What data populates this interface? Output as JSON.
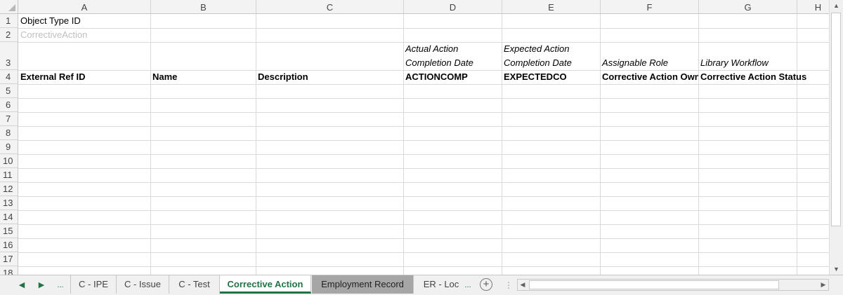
{
  "columns": [
    "A",
    "B",
    "C",
    "D",
    "E",
    "F",
    "G",
    "H"
  ],
  "rows": [
    "1",
    "2",
    "3",
    "4",
    "5",
    "6",
    "7",
    "8",
    "9",
    "10",
    "11",
    "12",
    "13",
    "14",
    "15",
    "16",
    "17",
    "18"
  ],
  "cells": {
    "a1": "Object Type ID",
    "a2": "CorrectiveAction",
    "d3_line1": "Actual Action",
    "d3_line2": "Completion Date",
    "e3_line1": "Expected Action",
    "e3_line2": "Completion Date",
    "f3": "Assignable Role",
    "g3": "Library Workflow",
    "a4": "External Ref ID",
    "b4": "Name",
    "c4": "Description",
    "d4": "ACTIONCOMP",
    "e4": "EXPECTEDCO",
    "f4": "Corrective Action Own",
    "g4": "Corrective Action Status"
  },
  "tabs": {
    "nav_prev": "◀",
    "nav_next": "▶",
    "ellipsis": "...",
    "items": [
      "C - IPE",
      "C - Issue",
      "C - Test",
      "Corrective Action",
      "Employment Record",
      "ER - Loc"
    ],
    "active": "Corrective Action",
    "more": "..."
  },
  "icons": {
    "add_sheet": "plus-circle-icon",
    "scroll_up": "triangle-up-icon",
    "scroll_down": "triangle-down-icon",
    "scroll_left": "triangle-left-icon",
    "scroll_right": "triangle-right-icon"
  },
  "colors": {
    "accent": "#217346",
    "colored_tab": "#a6a6a6",
    "header_bg": "#f3f3f3",
    "ghost_text": "#c0c0c0"
  }
}
